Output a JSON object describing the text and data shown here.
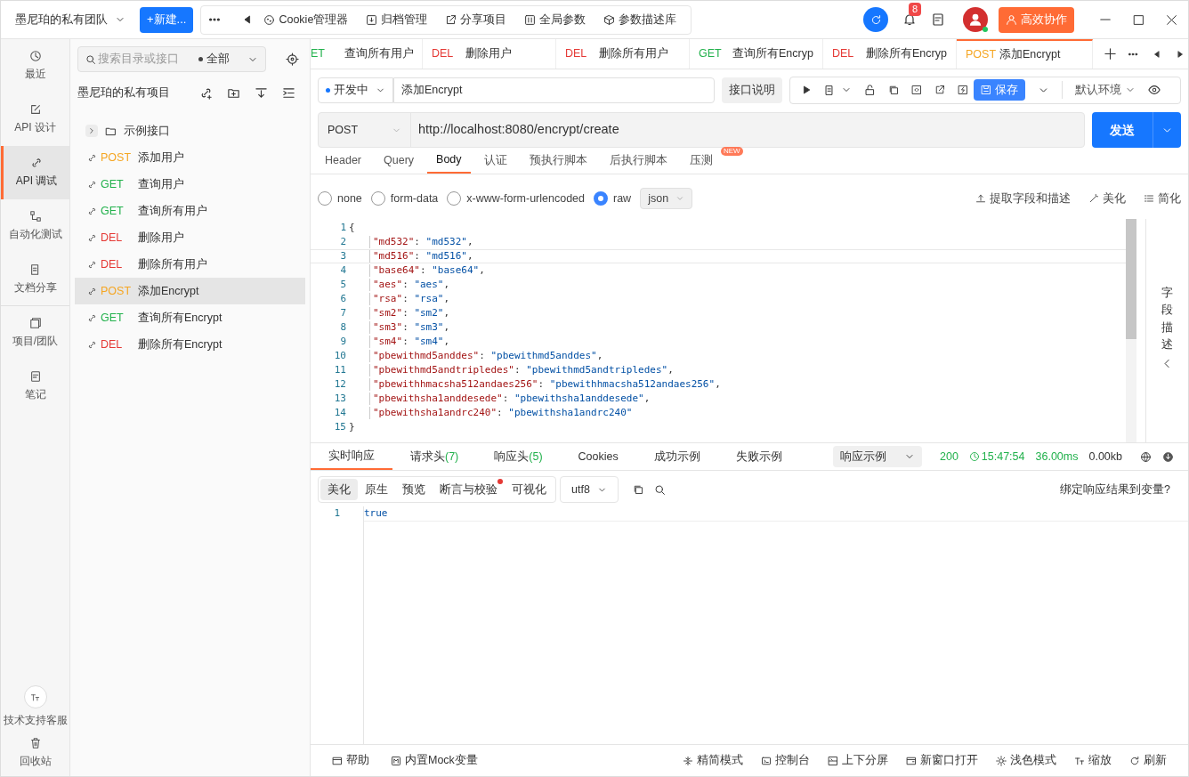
{
  "top_bar": {
    "team": "墨尼珀的私有团队",
    "new_button": "+新建...",
    "tools": [
      {
        "label": "Cookie管理器"
      },
      {
        "label": "归档管理"
      },
      {
        "label": "分享项目"
      },
      {
        "label": "全局参数"
      },
      {
        "label": "参数描述库"
      }
    ],
    "notification_count": "8",
    "collab_button": "高效协作"
  },
  "nav": {
    "items": [
      {
        "label": "最近",
        "selected": false
      },
      {
        "label": "API 设计",
        "selected": false
      },
      {
        "label": "API 调试",
        "selected": true
      },
      {
        "label": "自动化测试",
        "selected": false
      },
      {
        "label": "文档分享",
        "selected": false
      },
      {
        "label": "项目/团队",
        "selected": false
      },
      {
        "label": "笔记",
        "selected": false
      }
    ],
    "bottom_items": [
      {
        "label": "技术支持客服"
      },
      {
        "label": "回收站"
      }
    ]
  },
  "tree": {
    "search": {
      "placeholder": "搜索目录或接口"
    },
    "filter": "全部",
    "project": "墨尼珀的私有项目",
    "folder": {
      "label": "示例接口",
      "expanded": false
    },
    "items": [
      {
        "method": "POST",
        "kind": "post",
        "name": "添加用户",
        "selected": false
      },
      {
        "method": "GET",
        "kind": "get",
        "name": "查询用户",
        "selected": false
      },
      {
        "method": "GET",
        "kind": "get",
        "name": "查询所有用户",
        "selected": false
      },
      {
        "method": "DEL",
        "kind": "del",
        "name": "删除用户",
        "selected": false
      },
      {
        "method": "DEL",
        "kind": "del",
        "name": "删除所有用户",
        "selected": false
      },
      {
        "method": "POST",
        "kind": "post",
        "name": "添加Encrypt",
        "selected": true
      },
      {
        "method": "GET",
        "kind": "get",
        "name": "查询所有Encrypt",
        "selected": false
      },
      {
        "method": "DEL",
        "kind": "del",
        "name": "删除所有Encrypt",
        "selected": false
      }
    ]
  },
  "tabs": [
    {
      "method": "ET",
      "kind": "get",
      "name": "查询所有用户",
      "selected": false
    },
    {
      "method": "DEL",
      "kind": "del",
      "name": "删除用户",
      "selected": false
    },
    {
      "method": "DEL",
      "kind": "del",
      "name": "删除所有用户",
      "selected": false
    },
    {
      "method": "GET",
      "kind": "get",
      "name": "查询所有Encryp",
      "selected": false
    },
    {
      "method": "DEL",
      "kind": "del",
      "name": "删除所有Encryp",
      "selected": false
    },
    {
      "method": "POST",
      "kind": "post",
      "name": "添加Encrypt",
      "selected": true
    }
  ],
  "request": {
    "env_status": "开发中",
    "name": "添加Encrypt",
    "doc_button": "接口说明",
    "save_button": "保存",
    "environment": "默认环境",
    "method": "POST",
    "url": "http://localhost:8080/encrypt/create",
    "send_button": "发送"
  },
  "param_tabs": [
    {
      "label": "Header",
      "selected": false
    },
    {
      "label": "Query",
      "selected": false
    },
    {
      "label": "Body",
      "selected": true
    },
    {
      "label": "认证",
      "selected": false
    },
    {
      "label": "预执行脚本",
      "selected": false
    },
    {
      "label": "后执行脚本",
      "selected": false
    },
    {
      "label": "压测",
      "selected": false,
      "badge": "NEW"
    }
  ],
  "body_types": [
    {
      "label": "none",
      "selected": false
    },
    {
      "label": "form-data",
      "selected": false
    },
    {
      "label": "x-www-form-urlencoded",
      "selected": false
    },
    {
      "label": "raw",
      "selected": true
    }
  ],
  "body_format": "json",
  "body_actions": [
    {
      "label": "提取字段和描述"
    },
    {
      "label": "美化"
    },
    {
      "label": "简化"
    }
  ],
  "editor": {
    "lines": [
      {
        "number": "1",
        "text": "{",
        "current": false
      },
      {
        "number": "2",
        "key": "\"md532\"",
        "sep": ": ",
        "value": "\"md532\"",
        "end": ",",
        "current": false
      },
      {
        "number": "3",
        "key": "\"md516\"",
        "sep": ": ",
        "value": "\"md516\"",
        "end": ",",
        "current": true
      },
      {
        "number": "4",
        "key": "\"base64\"",
        "sep": ": ",
        "value": "\"base64\"",
        "end": ",",
        "current": false
      },
      {
        "number": "5",
        "key": "\"aes\"",
        "sep": ": ",
        "value": "\"aes\"",
        "end": ",",
        "current": false
      },
      {
        "number": "6",
        "key": "\"rsa\"",
        "sep": ": ",
        "value": "\"rsa\"",
        "end": ",",
        "current": false
      },
      {
        "number": "7",
        "key": "\"sm2\"",
        "sep": ": ",
        "value": "\"sm2\"",
        "end": ",",
        "current": false
      },
      {
        "number": "8",
        "key": "\"sm3\"",
        "sep": ": ",
        "value": "\"sm3\"",
        "end": ",",
        "current": false
      },
      {
        "number": "9",
        "key": "\"sm4\"",
        "sep": ": ",
        "value": "\"sm4\"",
        "end": ",",
        "current": false
      },
      {
        "number": "10",
        "key": "\"pbewithmd5anddes\"",
        "sep": ": ",
        "value": "\"pbewithmd5anddes\"",
        "end": ",",
        "current": false
      },
      {
        "number": "11",
        "key": "\"pbewithmd5andtripledes\"",
        "sep": ": ",
        "value": "\"pbewithmd5andtripledes\"",
        "end": ",",
        "current": false
      },
      {
        "number": "12",
        "key": "\"pbewithhmacsha512andaes256\"",
        "sep": ": ",
        "value": "\"pbewithhmacsha512andaes256\"",
        "end": ",",
        "current": false
      },
      {
        "number": "13",
        "key": "\"pbewithsha1anddesede\"",
        "sep": ": ",
        "value": "\"pbewithsha1anddesede\"",
        "end": ",",
        "current": false
      },
      {
        "number": "14",
        "key": "\"pbewithsha1andrc240\"",
        "sep": ": ",
        "value": "\"pbewithsha1andrc240\"",
        "current": false
      },
      {
        "number": "15",
        "text": "}",
        "current": false
      }
    ],
    "side_panel": "字段描述"
  },
  "response": {
    "tabs": [
      {
        "label": "实时响应",
        "selected": true
      },
      {
        "label": "请求头",
        "count": "(7)",
        "selected": false
      },
      {
        "label": "响应头",
        "count": "(5)",
        "selected": false
      },
      {
        "label": "Cookies",
        "selected": false
      },
      {
        "label": "成功示例",
        "selected": false
      },
      {
        "label": "失败示例",
        "selected": false
      }
    ],
    "example_select": "响应示例",
    "status": "200",
    "time": "15:47:54",
    "duration": "36.00ms",
    "size": "0.00kb",
    "views": [
      {
        "label": "美化",
        "selected": true,
        "dot": false
      },
      {
        "label": "原生",
        "selected": false,
        "dot": false
      },
      {
        "label": "预览",
        "selected": false,
        "dot": false
      },
      {
        "label": "断言与校验",
        "selected": false,
        "dot": true
      },
      {
        "label": "可视化",
        "selected": false,
        "dot": false
      }
    ],
    "encoding": "utf8",
    "bind_link": "绑定响应结果到变量?",
    "lines": [
      {
        "number": "1",
        "text": "true"
      }
    ]
  },
  "status_bar": {
    "left": [
      {
        "label": "帮助"
      },
      {
        "label": "内置Mock变量"
      }
    ],
    "right": [
      {
        "label": "精简模式"
      },
      {
        "label": "控制台"
      },
      {
        "label": "上下分屏"
      },
      {
        "label": "新窗口打开"
      },
      {
        "label": "浅色模式"
      },
      {
        "label": "缩放"
      },
      {
        "label": "刷新"
      }
    ]
  }
}
